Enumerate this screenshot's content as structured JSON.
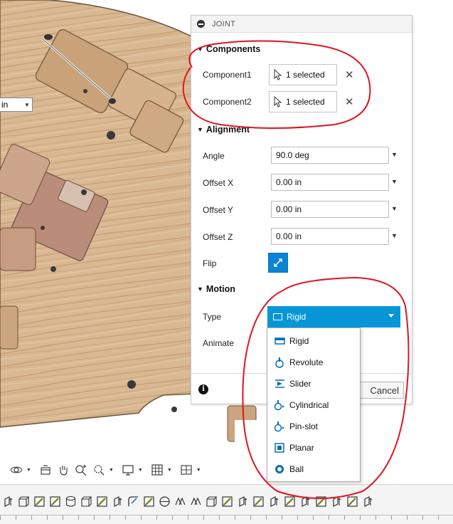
{
  "viewport": {
    "units_value": "in"
  },
  "joint_panel": {
    "title": "JOINT",
    "components_section": "Components",
    "component1_label": "Component1",
    "component1_value": "1 selected",
    "component2_label": "Component2",
    "component2_value": "1 selected",
    "alignment_section": "Alignment",
    "angle_label": "Angle",
    "angle_value": "90.0 deg",
    "offset_x_label": "Offset X",
    "offset_x_value": "0.00 in",
    "offset_y_label": "Offset Y",
    "offset_y_value": "0.00 in",
    "offset_z_label": "Offset Z",
    "offset_z_value": "0.00 in",
    "flip_label": "Flip",
    "motion_section": "Motion",
    "type_label": "Type",
    "type_value": "Rigid",
    "animate_label": "Animate",
    "cancel_label": "Cancel",
    "accent_color": "#0696d7"
  },
  "type_options": [
    {
      "label": "Rigid",
      "icon": "rigid-icon"
    },
    {
      "label": "Revolute",
      "icon": "revolute-icon"
    },
    {
      "label": "Slider",
      "icon": "slider-icon"
    },
    {
      "label": "Cylindrical",
      "icon": "cylindrical-icon"
    },
    {
      "label": "Pin-slot",
      "icon": "pin-slot-icon"
    },
    {
      "label": "Planar",
      "icon": "planar-icon"
    },
    {
      "label": "Ball",
      "icon": "ball-icon"
    }
  ],
  "annotation_color": "#e0141e"
}
